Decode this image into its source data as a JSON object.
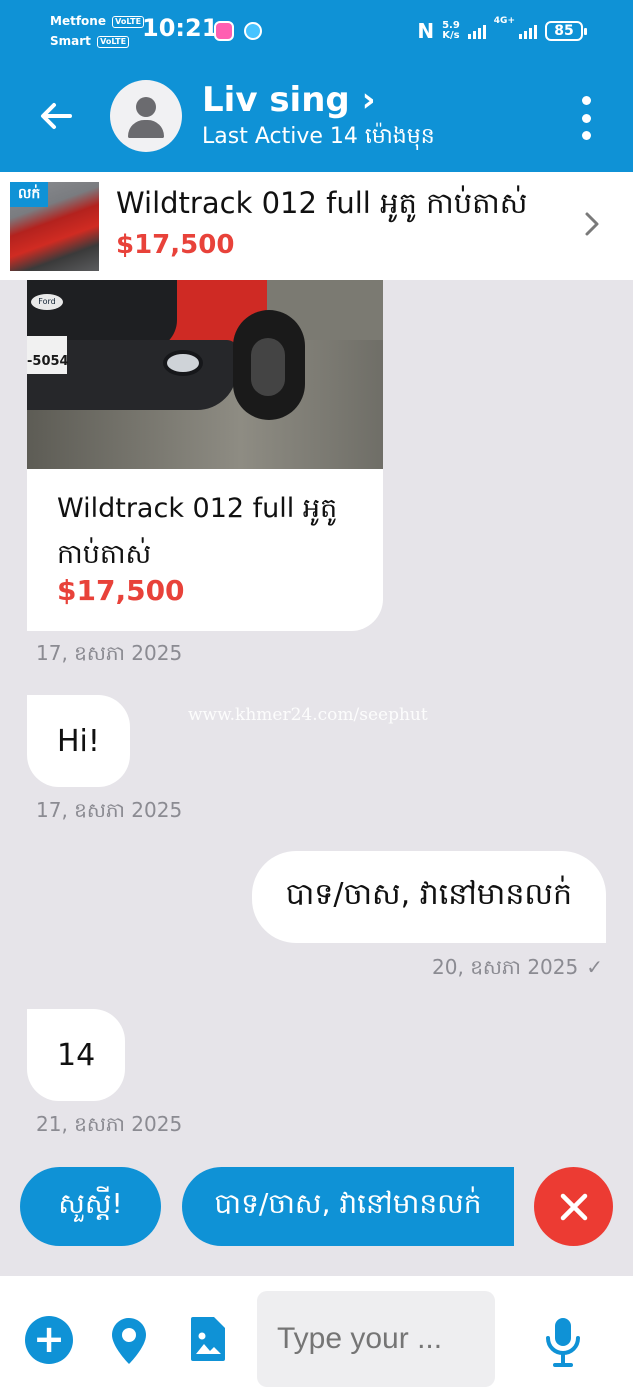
{
  "status_bar": {
    "carrier1": "Metfone",
    "carrier2": "Smart",
    "volte": "VoLTE",
    "time": "10:21",
    "speed_value": "5.9",
    "speed_unit": "K/s",
    "network": "4G+",
    "battery": "85"
  },
  "header": {
    "contact_name": "Liv sing",
    "name_chevron": "›",
    "last_active": "Last Active 14 ម៉ោងមុន"
  },
  "listing": {
    "badge": "លក់",
    "title": "Wildtrack 012 full អូតូ កាប់តាស់",
    "price": "$17,500"
  },
  "messages": {
    "product_card": {
      "plate": "-5054",
      "title": "Wildtrack 012 full អូតូ កាប់តាស់",
      "price": "$17,500",
      "timestamp": "17, ឧសភា 2025"
    },
    "msg1": {
      "text": "Hi!",
      "timestamp": "17, ឧសភា 2025"
    },
    "msg2": {
      "text": "បាទ/ចាស, វានៅមានលក់",
      "timestamp": "20, ឧសភា 2025",
      "status": "✓"
    },
    "msg3": {
      "text": "14",
      "timestamp": "21, ឧសភា 2025"
    }
  },
  "watermark": "www.khmer24.com/seephut",
  "quick_replies": [
    {
      "label": "សួស្តី!"
    },
    {
      "label": "បាទ/ចាស, វានៅមានលក់"
    }
  ],
  "composer": {
    "placeholder": "Type your ..."
  },
  "colors": {
    "brand": "#0f92d6",
    "price": "#e8423a",
    "close": "#ec3b33",
    "chat_bg": "#e6e4e9"
  }
}
